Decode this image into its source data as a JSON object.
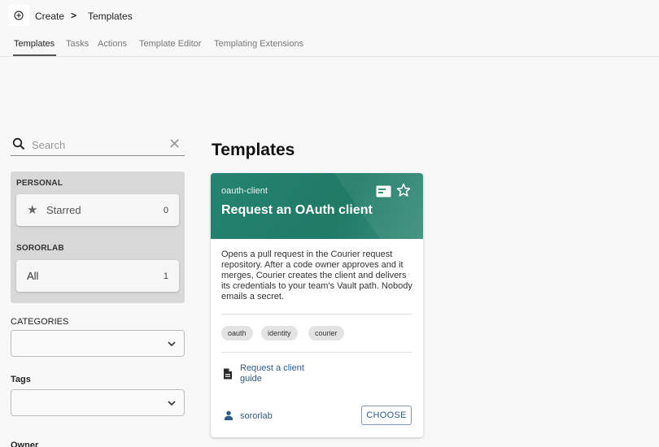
{
  "breadcrumb": {
    "icon": "plus-circle-icon",
    "create": "Create",
    "separator": ">",
    "current": "Templates"
  },
  "tabs": [
    {
      "label": "Templates",
      "active": true
    },
    {
      "label": "Tasks"
    },
    {
      "label": "Actions"
    },
    {
      "label": "Template Editor"
    },
    {
      "label": "Templating Extensions"
    }
  ],
  "sidebar": {
    "search": {
      "placeholder": "Search",
      "value": "",
      "clear_glyph": "✕"
    },
    "personal": {
      "heading": "PERSONAL",
      "starred": {
        "label": "Starred",
        "count": "0"
      }
    },
    "org": {
      "heading": "SORORLAB",
      "all": {
        "label": "All",
        "count": "1"
      }
    },
    "categories": {
      "label": "CATEGORIES",
      "value": ""
    },
    "tags": {
      "label": "Tags",
      "value": ""
    },
    "owner": {
      "label": "Owner"
    }
  },
  "main": {
    "title": "Templates",
    "card": {
      "type": "oauth-client",
      "title": "Request an OAuth client",
      "description": "Opens a pull request in the Courier request repository. After a code owner approves and it merges, Courier creates the client and delivers its credentials to your team's Vault path. Nobody emails a secret.",
      "tags": [
        "oauth",
        "identity",
        "courier"
      ],
      "link": "Request a client guide",
      "owner": "sororlab",
      "choose": "CHOOSE"
    }
  },
  "colors": {
    "header_green": "#25836f",
    "link_blue": "#2e5c88",
    "panel_gray": "#d8d8d8"
  }
}
